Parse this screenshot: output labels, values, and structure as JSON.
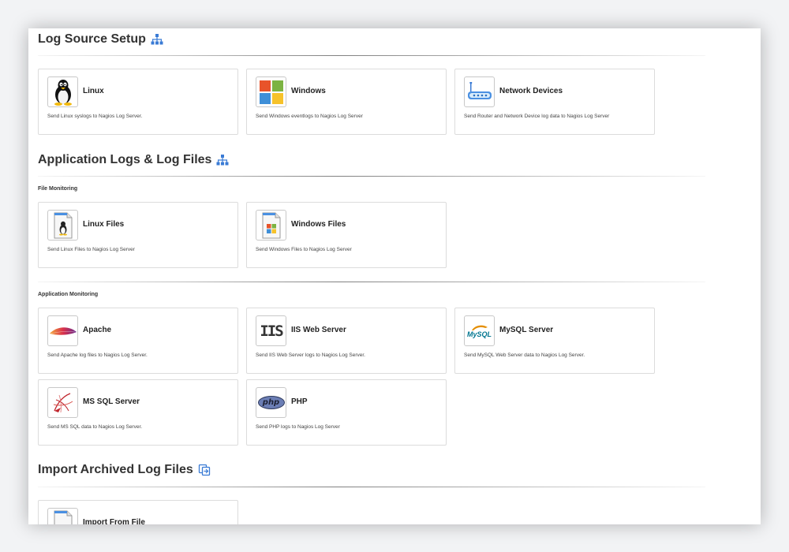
{
  "sections": {
    "log_source_setup": {
      "title": "Log Source Setup",
      "cards": [
        {
          "name": "Linux",
          "desc": "Send Linux syslogs to Nagios Log Server."
        },
        {
          "name": "Windows",
          "desc": "Send Windows eventlogs to Nagios Log Server"
        },
        {
          "name": "Network Devices",
          "desc": "Send Router and Network Device log data to Nagios Log Server"
        }
      ]
    },
    "application_logs": {
      "title": "Application Logs & Log Files",
      "file_monitoring": {
        "label": "File Monitoring",
        "cards": [
          {
            "name": "Linux Files",
            "desc": "Send Linux Files to Nagios Log Server"
          },
          {
            "name": "Windows Files",
            "desc": "Send Windows Files to Nagios Log Server"
          }
        ]
      },
      "application_monitoring": {
        "label": "Application Monitoring",
        "cards": [
          {
            "name": "Apache",
            "desc": "Send Apache log files to Nagios Log Server."
          },
          {
            "name": "IIS Web Server",
            "desc": "Send IIS Web Server logs to Nagios Log Server."
          },
          {
            "name": "MySQL Server",
            "desc": "Send MySQL Web Server data to Nagios Log Server."
          },
          {
            "name": "MS SQL Server",
            "desc": "Send MS SQL data to Nagios Log Server."
          },
          {
            "name": "PHP",
            "desc": "Send PHP logs to Nagios Log Server"
          }
        ]
      }
    },
    "import_archived": {
      "title": "Import Archived Log Files",
      "cards": [
        {
          "name": "Import From File",
          "desc": ""
        }
      ]
    }
  },
  "logo_text": {
    "iis": "IIS",
    "mysql": "MySQL",
    "php": "php"
  },
  "colors": {
    "accent_blue": "#3a7bd5",
    "card_border": "#dcdcdc",
    "title_text": "#333333"
  }
}
